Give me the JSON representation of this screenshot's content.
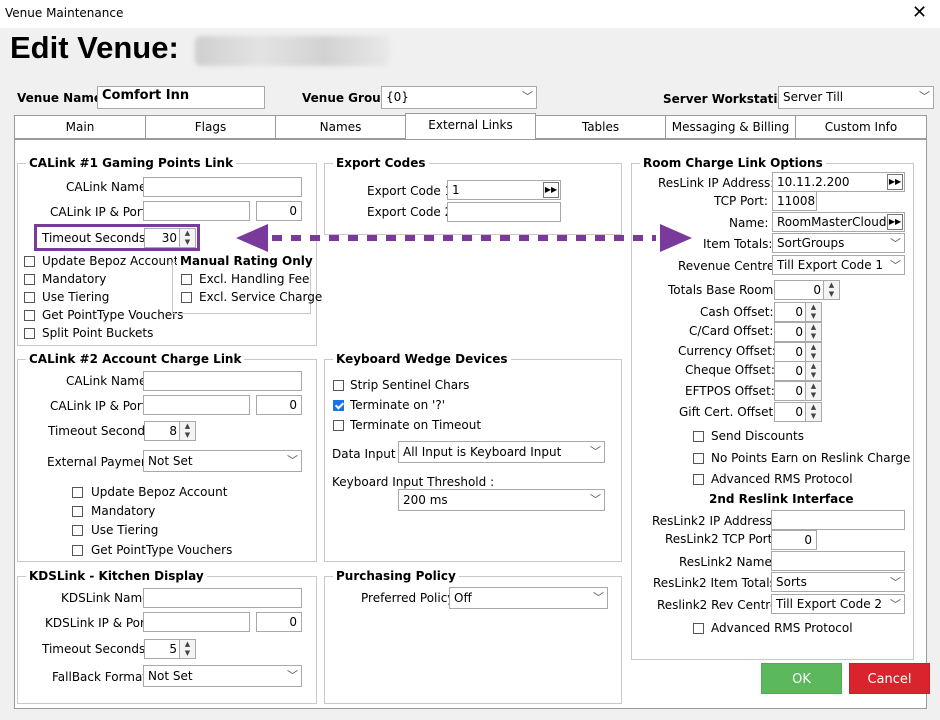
{
  "window": {
    "title": "Venue Maintenance",
    "close": "✕"
  },
  "heading": "Edit Venue:",
  "top": {
    "venue_name_label": "Venue Name:",
    "venue_name_value": "Comfort Inn",
    "venue_group_label": "Venue Group:",
    "venue_group_value": "{0}",
    "server_ws_label": "Server Workstation:",
    "server_ws_value": "Server Till"
  },
  "tabs": [
    "Main",
    "Flags",
    "Names",
    "External Links",
    "Tables",
    "Messaging & Billing",
    "Custom Info"
  ],
  "active_tab": "External Links",
  "calink1": {
    "title": "CALink #1 Gaming Points Link",
    "name_label": "CALink Name:",
    "name_value": "",
    "ip_label": "CALink IP & Port:",
    "ip_value": "",
    "port_value": "0",
    "timeout_label": "Timeout Seconds:",
    "timeout_value": "30",
    "checks": [
      "Update Bepoz Account",
      "Mandatory",
      "Use Tiering",
      "Get PointType Vouchers",
      "Split Point Buckets"
    ],
    "manual_title": "Manual Rating Only",
    "manual_checks": [
      "Excl. Handling Fee",
      "Excl. Service Charge"
    ]
  },
  "calink2": {
    "title": "CALink #2 Account Charge Link",
    "name_label": "CALink Name:",
    "name_value": "",
    "ip_label": "CALink IP & Port:",
    "ip_value": "",
    "port_value": "0",
    "timeout_label": "Timeout Seconds:",
    "timeout_value": "8",
    "ext_label": "External Payment:",
    "ext_value": "Not Set",
    "checks": [
      "Update Bepoz Account",
      "Mandatory",
      "Use Tiering",
      "Get PointType Vouchers"
    ]
  },
  "kds": {
    "title": "KDSLink - Kitchen Display",
    "name_label": "KDSLink Name:",
    "name_value": "",
    "ip_label": "KDSLink IP & Port:",
    "ip_value": "",
    "port_value": "0",
    "timeout_label": "Timeout Seconds:",
    "timeout_value": "5",
    "fallback_label": "FallBack Format:",
    "fallback_value": "Not Set"
  },
  "export": {
    "title": "Export Codes",
    "code1_label": "Export Code 1:",
    "code1_value": "1",
    "code2_label": "Export Code 2:",
    "code2_value": ""
  },
  "wedge": {
    "title": "Keyboard Wedge Devices",
    "checks": [
      {
        "label": "Strip Sentinel Chars",
        "checked": false
      },
      {
        "label": "Terminate on '?'",
        "checked": true
      },
      {
        "label": "Terminate on Timeout",
        "checked": false
      }
    ],
    "data_input_label": "Data Input :",
    "data_input_value": "All Input is Keyboard Input",
    "threshold_label": "Keyboard Input Threshold :",
    "threshold_value": "200 ms"
  },
  "purchasing": {
    "title": "Purchasing Policy",
    "policy_label": "Preferred Policy:",
    "policy_value": "Off"
  },
  "room": {
    "title": "Room Charge Link Options",
    "ip_label": "ResLink  IP Address:",
    "ip_value": "10.11.2.200",
    "port_label": "TCP Port:",
    "port_value": "11008",
    "name_label": "Name:",
    "name_value": "RoomMasterCloud",
    "items_label": "Item Totals:",
    "items_value": "SortGroups",
    "revenue_label": "Revenue Centre:",
    "revenue_value": "Till Export Code 1",
    "base_label": "Totals Base Room:",
    "base_value": "0",
    "offsets": [
      {
        "label": "Cash Offset:",
        "value": "0"
      },
      {
        "label": "C/Card Offset:",
        "value": "0"
      },
      {
        "label": "Currency Offset:",
        "value": "0"
      },
      {
        "label": "Cheque Offset:",
        "value": "0"
      },
      {
        "label": "EFTPOS Offset:",
        "value": "0"
      },
      {
        "label": "Gift Cert. Offset:",
        "value": "0"
      }
    ],
    "checks": [
      "Send Discounts",
      "No Points Earn on Reslink Charge",
      "Advanced RMS Protocol"
    ],
    "second_title": "2nd Reslink Interface",
    "r2_ip_label": "ResLink2  IP Address:",
    "r2_ip_value": "",
    "r2_port_label": "ResLink2 TCP Port:",
    "r2_port_value": "0",
    "r2_name_label": "ResLink2 Name:",
    "r2_name_value": "",
    "r2_items_label": "ResLink2 Item Totals:",
    "r2_items_value": "Sorts",
    "r2_rev_label": "Reslink2 Rev Centre:",
    "r2_rev_value": "Till Export Code 2",
    "r2_check": "Advanced RMS Protocol"
  },
  "buttons": {
    "ok": "OK",
    "cancel": "Cancel"
  },
  "colors": {
    "arrow": "#7a3a9c",
    "ok": "#5cb85c",
    "cancel": "#d9232d",
    "check": "#1a73e8"
  }
}
